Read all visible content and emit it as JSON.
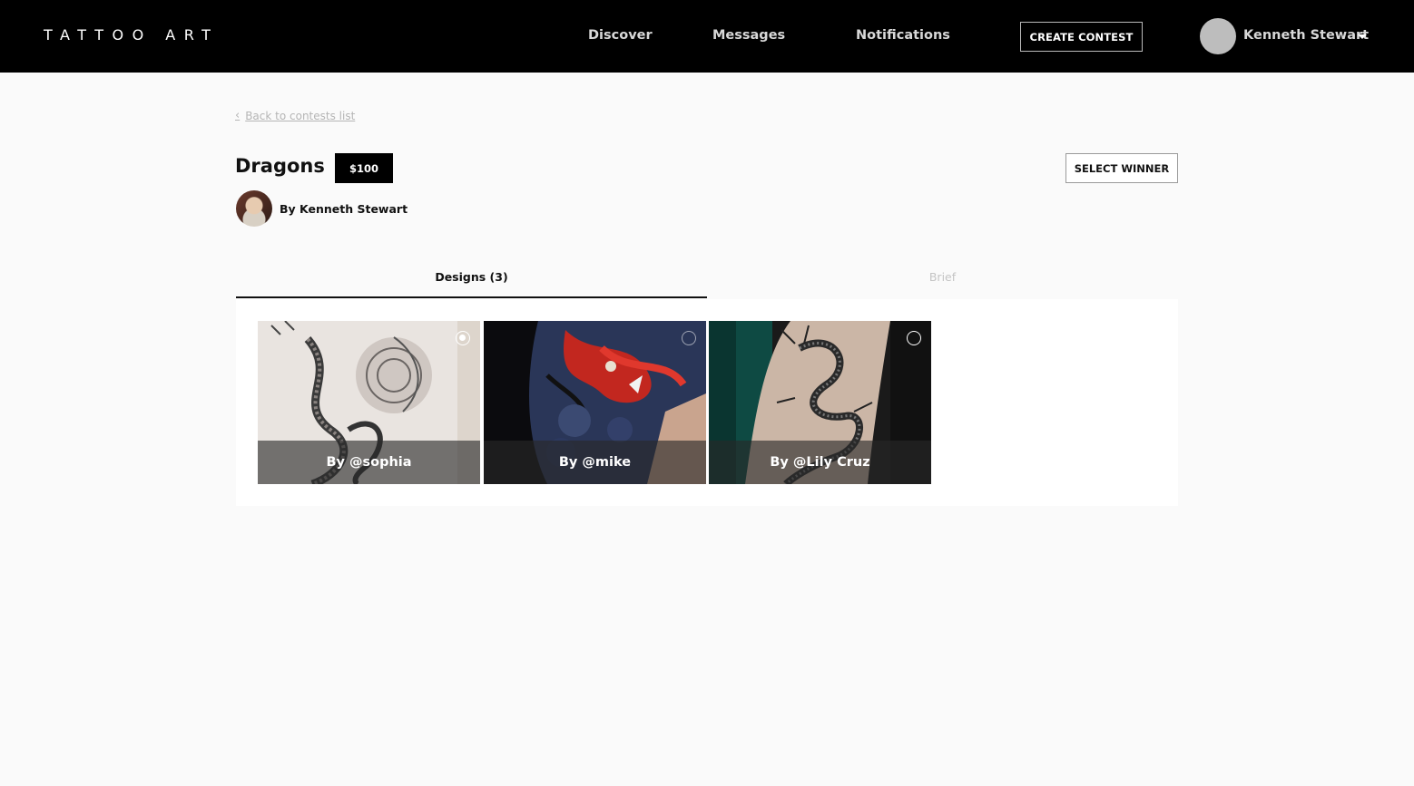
{
  "header": {
    "logo": "TATTOO ART",
    "nav": [
      "Discover",
      "Messages",
      "Notifications"
    ],
    "create_button": "CREATE CONTEST",
    "user_name": "Kenneth Stewart"
  },
  "contest": {
    "back_link": "Back to contests list",
    "title": "Dragons",
    "prize": "$100",
    "select_winner": "SELECT WINNER",
    "author": "By Kenneth Stewart"
  },
  "tabs": {
    "designs": "Designs (3)",
    "brief": "Brief",
    "active": "designs"
  },
  "designs": [
    {
      "caption": "By @sophia",
      "selected": true
    },
    {
      "caption": "By @mike",
      "selected": false
    },
    {
      "caption": "By @Lily Cruz",
      "selected": false
    }
  ],
  "colors": {
    "header_bg": "#000000",
    "page_bg": "#fafafa",
    "accent": "#000000"
  }
}
